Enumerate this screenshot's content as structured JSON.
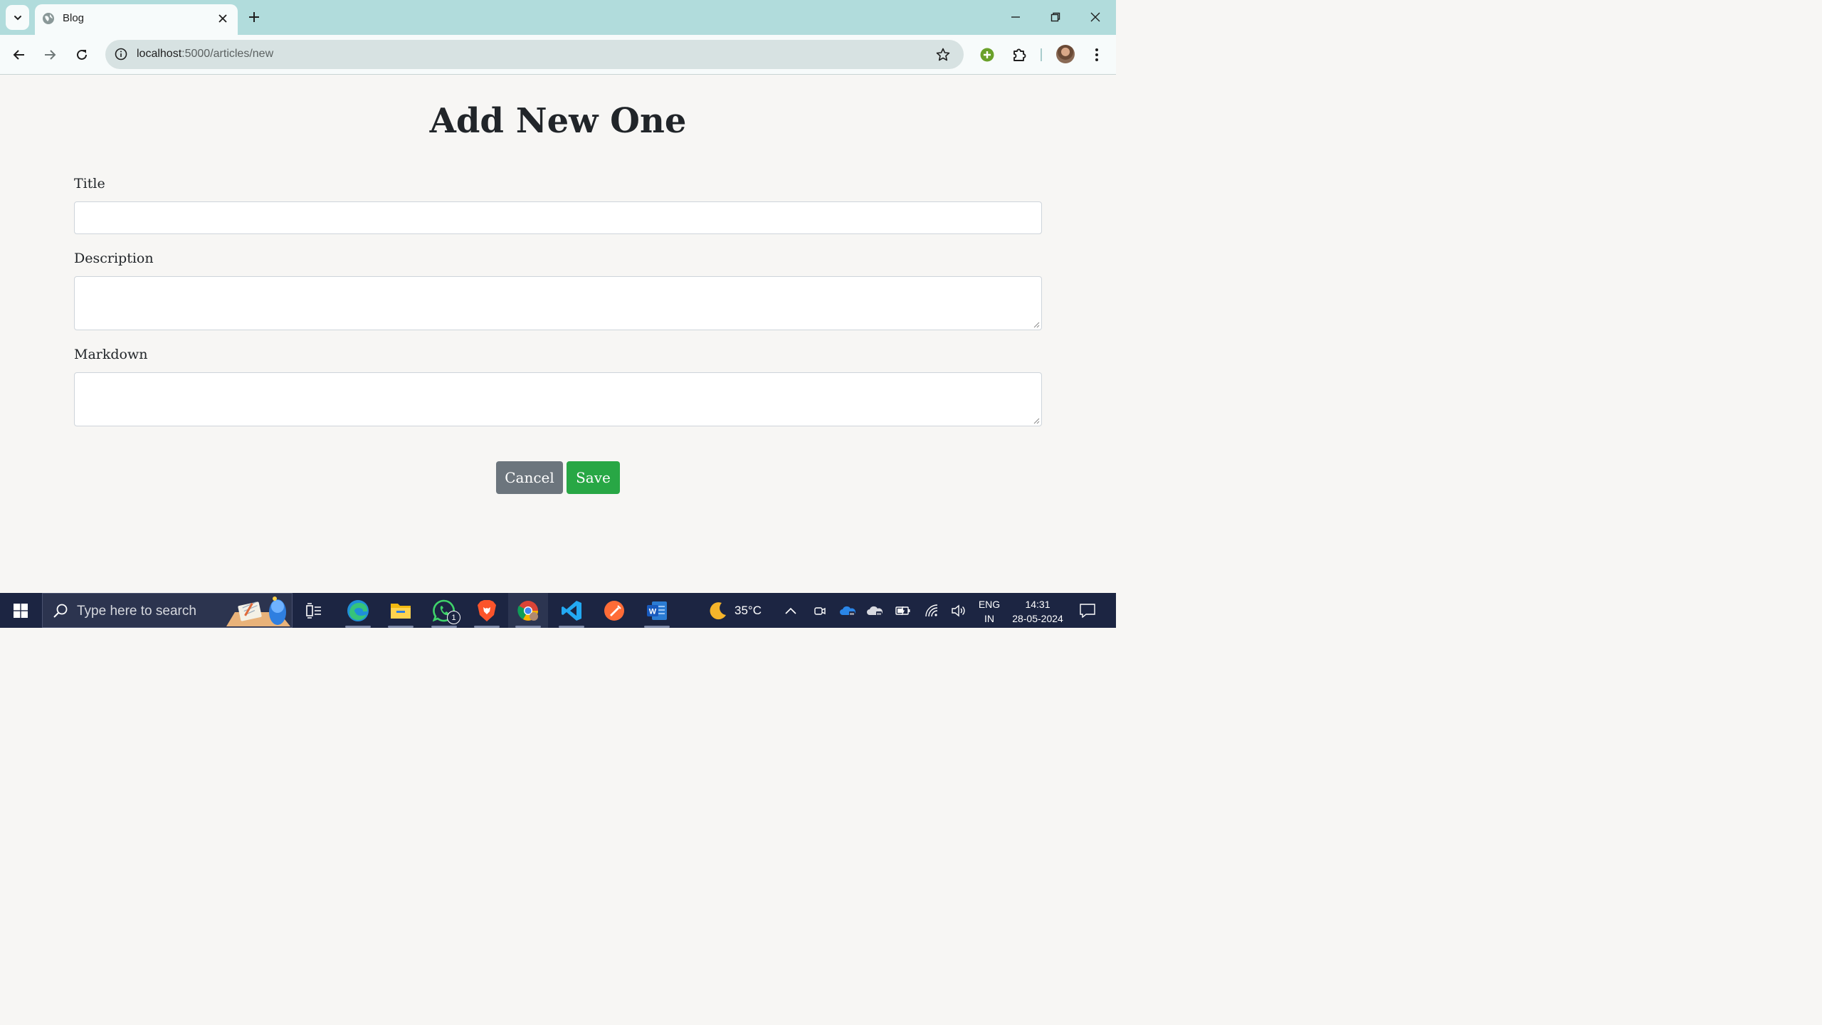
{
  "browser": {
    "tab_title": "Blog",
    "url_host": "localhost",
    "url_rest": ":5000/articles/new",
    "icons": [
      "tab-search-icon",
      "globe-icon",
      "close-icon",
      "plus-icon",
      "minimize-icon",
      "restore-icon",
      "back-icon",
      "forward-icon",
      "reload-icon",
      "site-info-icon",
      "star-icon",
      "extension-add-icon",
      "extensions-icon",
      "profile-avatar",
      "menu-icon"
    ]
  },
  "page": {
    "heading": "Add New One",
    "form": {
      "title_label": "Title",
      "title_value": "",
      "description_label": "Description",
      "description_value": "",
      "markdown_label": "Markdown",
      "markdown_value": ""
    },
    "buttons": {
      "cancel": "Cancel",
      "save": "Save"
    },
    "colors": {
      "background": "#f7f6f4",
      "cancel": "#6c757d",
      "save": "#28a745"
    }
  },
  "taskbar": {
    "search_placeholder": "Type here to search",
    "apps": [
      "task-view",
      "edge",
      "file-explorer",
      "whatsapp",
      "brave",
      "chrome",
      "vscode",
      "postman",
      "word"
    ],
    "whatsapp_badge": "1",
    "weather_temp": "35°C",
    "language_top": "ENG",
    "language_bottom": "IN",
    "time": "14:31",
    "date": "28-05-2024"
  }
}
